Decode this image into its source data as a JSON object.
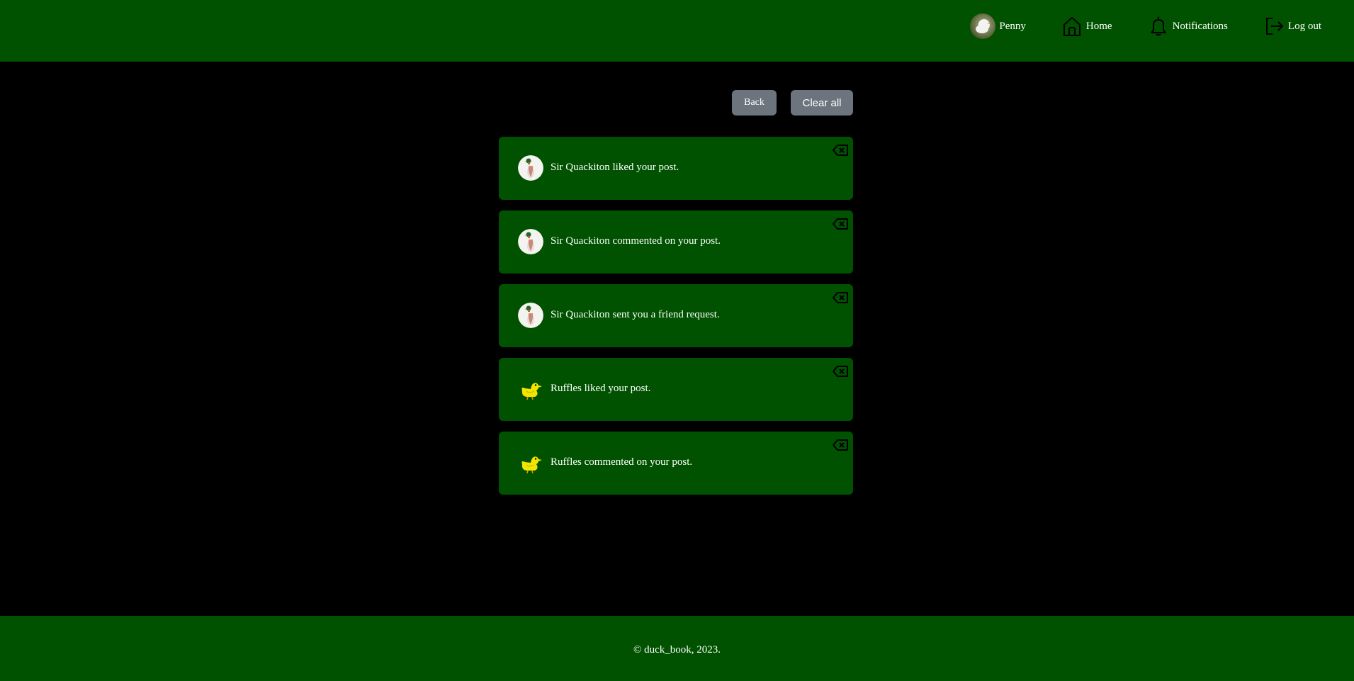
{
  "colors": {
    "nav_bg": "#005200",
    "page_bg": "#000000",
    "card_bg": "#005200",
    "button_bg": "#6c757d",
    "text": "#ffffff"
  },
  "nav": {
    "profile_label": "Penny",
    "home_label": "Home",
    "notifications_label": "Notifications",
    "logout_label": "Log out",
    "profile_icon": "duck-avatar",
    "home_icon": "house-icon",
    "notifications_icon": "bell-icon",
    "logout_icon": "logout-icon"
  },
  "actions": {
    "back_label": "Back",
    "clear_label": "Clear all"
  },
  "notifications": [
    {
      "message": "Sir Quackiton liked your post.",
      "avatar": "mallard-avatar"
    },
    {
      "message": "Sir Quackiton commented on your post.",
      "avatar": "mallard-avatar"
    },
    {
      "message": "Sir Quackiton sent you a friend request.",
      "avatar": "mallard-avatar"
    },
    {
      "message": "Ruffles liked your post.",
      "avatar": "yellow-duck-avatar"
    },
    {
      "message": "Ruffles commented on your post.",
      "avatar": "yellow-duck-avatar"
    }
  ],
  "footer": {
    "copyright": "© duck_book, 2023."
  }
}
